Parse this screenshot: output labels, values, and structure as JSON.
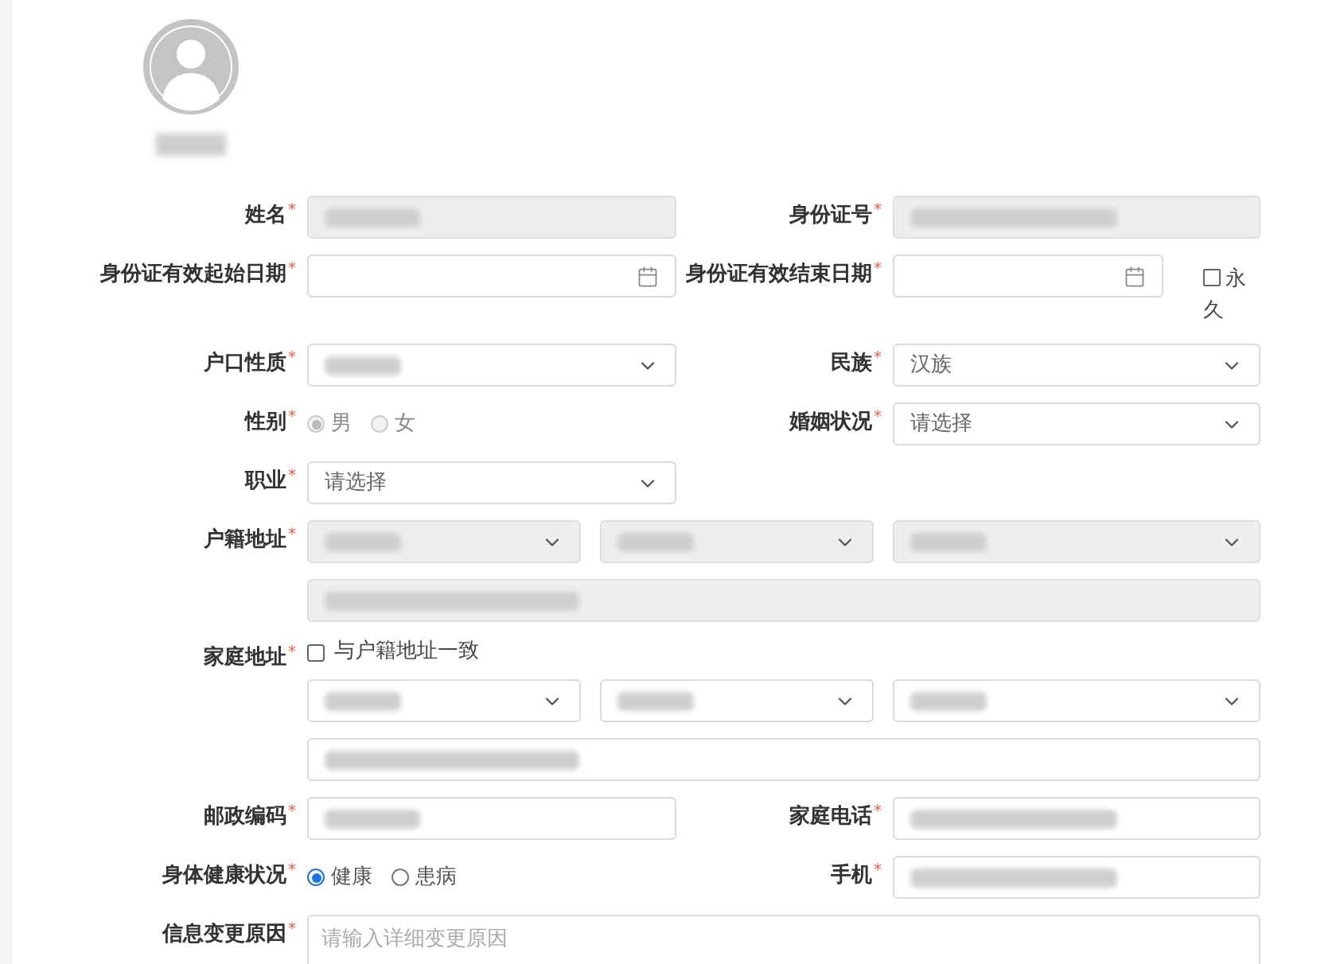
{
  "required_mark": "*",
  "rows": [
    {
      "cells": [
        {
          "label": "姓名",
          "required": true,
          "control": {
            "kind": "text",
            "disabled": true,
            "blurred": true
          }
        },
        {
          "label": "身份证号",
          "required": true,
          "control": {
            "kind": "text",
            "disabled": true,
            "blurred": true
          }
        }
      ]
    },
    {
      "cells": [
        {
          "label": "身份证有效起始日期",
          "required": true,
          "control": {
            "kind": "date",
            "disabled": false
          }
        },
        {
          "label": "身份证有效结束日期",
          "required": true,
          "control": {
            "kind": "date",
            "disabled": false
          },
          "extra": {
            "label": "永久",
            "checked": false
          }
        }
      ]
    },
    {
      "cells": [
        {
          "label": "户口性质",
          "required": true,
          "control": {
            "kind": "select",
            "disabled": false,
            "blurred": true
          }
        },
        {
          "label": "民族",
          "required": true,
          "control": {
            "kind": "select",
            "disabled": false,
            "value": "汉族"
          }
        }
      ]
    },
    {
      "cells": [
        {
          "label": "性别",
          "required": true,
          "control": {
            "kind": "radio",
            "disabled": true,
            "options": [
              {
                "label": "男",
                "selected": true
              },
              {
                "label": "女",
                "selected": false
              }
            ]
          }
        },
        {
          "label": "婚姻状况",
          "required": true,
          "control": {
            "kind": "select",
            "disabled": false,
            "value": "请选择"
          }
        }
      ]
    },
    {
      "cells": [
        {
          "label": "职业",
          "required": true,
          "control": {
            "kind": "select",
            "disabled": false,
            "value": "请选择"
          }
        }
      ]
    },
    {
      "cells": [
        {
          "label": "户籍地址",
          "required": true,
          "control": {
            "kind": "address",
            "disabled": true,
            "selects": [
              {
                "blurred": true
              },
              {
                "blurred": true
              },
              {
                "blurred": true
              }
            ],
            "street": {
              "blurred": true
            }
          }
        }
      ]
    },
    {
      "cells": [
        {
          "label": "家庭地址",
          "required": true,
          "control": {
            "kind": "address",
            "disabled": false,
            "same_as": {
              "label": "与户籍地址一致",
              "checked": false
            },
            "selects": [
              {
                "blurred": true
              },
              {
                "blurred": true
              },
              {
                "blurred": true
              }
            ],
            "street": {
              "blurred": true
            }
          }
        }
      ]
    },
    {
      "cells": [
        {
          "label": "邮政编码",
          "required": true,
          "control": {
            "kind": "text",
            "disabled": false,
            "blurred": true
          }
        },
        {
          "label": "家庭电话",
          "required": true,
          "control": {
            "kind": "text",
            "disabled": false,
            "blurred": true
          }
        }
      ]
    },
    {
      "cells": [
        {
          "label": "身体健康状况",
          "required": true,
          "control": {
            "kind": "radio",
            "disabled": false,
            "options": [
              {
                "label": "健康",
                "selected": true
              },
              {
                "label": "患病",
                "selected": false
              }
            ]
          }
        },
        {
          "label": "手机",
          "required": true,
          "control": {
            "kind": "text",
            "disabled": false,
            "blurred": true
          }
        }
      ]
    },
    {
      "cells": [
        {
          "label": "信息变更原因",
          "required": true,
          "control": {
            "kind": "textarea",
            "disabled": false,
            "placeholder": "请输入详细变更原因"
          }
        }
      ]
    }
  ]
}
